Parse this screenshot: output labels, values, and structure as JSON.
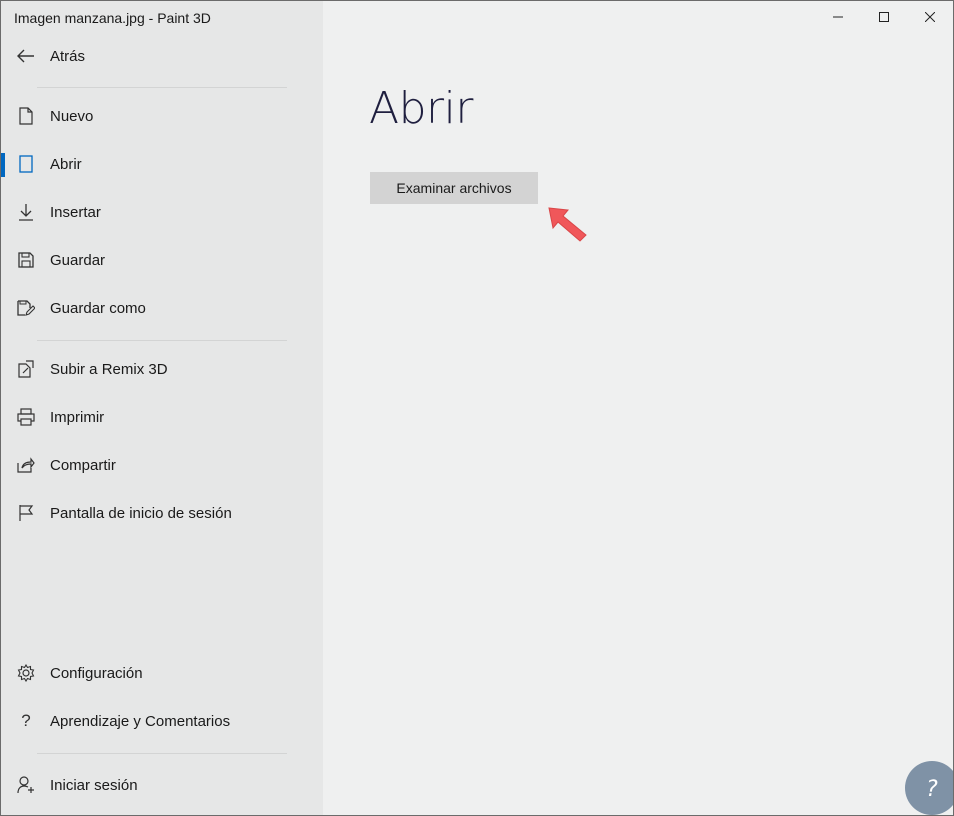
{
  "window": {
    "title": "Imagen manzana.jpg - Paint 3D"
  },
  "sidebar": {
    "back_label": "Atrás",
    "items_top": [
      {
        "label": "Nuevo",
        "icon": "new-file-icon"
      },
      {
        "label": "Abrir",
        "icon": "open-file-icon",
        "selected": true
      },
      {
        "label": "Insertar",
        "icon": "download-arrow-icon"
      },
      {
        "label": "Guardar",
        "icon": "save-icon"
      },
      {
        "label": "Guardar como",
        "icon": "save-as-icon"
      }
    ],
    "items_mid": [
      {
        "label": "Subir a Remix 3D",
        "icon": "upload-remix-icon"
      },
      {
        "label": "Imprimir",
        "icon": "print-icon"
      },
      {
        "label": "Compartir",
        "icon": "share-icon"
      },
      {
        "label": "Pantalla de inicio de sesión",
        "icon": "flag-icon"
      }
    ],
    "items_bottom": [
      {
        "label": "Configuración",
        "icon": "gear-icon"
      },
      {
        "label": "Aprendizaje y Comentarios",
        "icon": "question-icon"
      }
    ],
    "signin_label": "Iniciar sesión"
  },
  "main": {
    "title": "Abrir",
    "browse_button": "Examinar archivos"
  },
  "colors": {
    "accent": "#0067c0",
    "annotation_arrow": "#f0575a"
  }
}
